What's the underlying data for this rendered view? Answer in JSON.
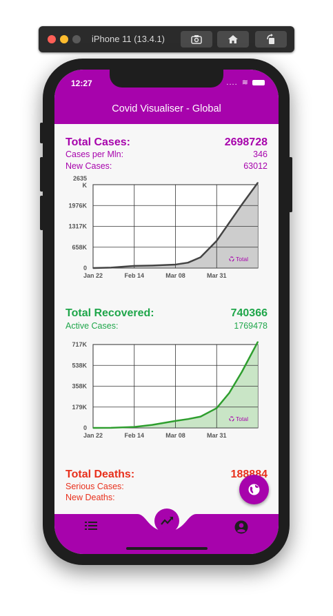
{
  "simulator": {
    "title": "iPhone 11 (13.4.1)"
  },
  "status_bar": {
    "time": "12:27",
    "signal": "....",
    "wifi": "≋"
  },
  "app": {
    "title": "Covid Visualiser - Global",
    "accent": "#a703ac"
  },
  "cases": {
    "title": "Total Cases:",
    "total": "2698728",
    "per_mln_label": "Cases per Mln:",
    "per_mln": "346",
    "new_label": "New Cases:",
    "new": "63012"
  },
  "recovered": {
    "title": "Total Recovered:",
    "total": "740366",
    "active_label": "Active Cases:",
    "active": "1769478"
  },
  "deaths": {
    "title": "Total Deaths:",
    "total": "188884",
    "serious_label": "Serious Cases:",
    "new_label": "New Deaths:"
  },
  "chart_data": [
    {
      "type": "area",
      "title": "",
      "legend": "Total",
      "yticks": [
        "0",
        "658K",
        "1317K",
        "1976K",
        "2635\nK"
      ],
      "xticks": [
        "Jan 22",
        "Feb 14",
        "Mar 08",
        "Mar 31"
      ],
      "ylim": [
        0,
        2635000
      ],
      "color": "#444444",
      "fill": "#c8c8c8",
      "x": [
        "Jan 22",
        "Feb 01",
        "Feb 14",
        "Feb 24",
        "Mar 08",
        "Mar 15",
        "Mar 22",
        "Mar 31",
        "Apr 07",
        "Apr 14",
        "Apr 23"
      ],
      "values": [
        600,
        14000,
        67000,
        80000,
        110000,
        170000,
        340000,
        860000,
        1430000,
        2000000,
        2698728
      ]
    },
    {
      "type": "area",
      "title": "",
      "legend": "Total",
      "yticks": [
        "0",
        "179K",
        "358K",
        "538K",
        "717K"
      ],
      "xticks": [
        "Jan 22",
        "Feb 14",
        "Mar 08",
        "Mar 31"
      ],
      "ylim": [
        0,
        717000
      ],
      "color": "#2e9e2e",
      "fill": "#c3e2c0",
      "x": [
        "Jan 22",
        "Feb 01",
        "Feb 14",
        "Feb 24",
        "Mar 08",
        "Mar 15",
        "Mar 22",
        "Mar 31",
        "Apr 07",
        "Apr 14",
        "Apr 23"
      ],
      "values": [
        30,
        500,
        8000,
        26000,
        60000,
        76000,
        97000,
        170000,
        300000,
        480000,
        740366
      ]
    }
  ],
  "icons": {
    "list": "list-icon",
    "trend": "trending-up-icon",
    "profile": "account-circle-icon",
    "globe": "globe-icon"
  }
}
